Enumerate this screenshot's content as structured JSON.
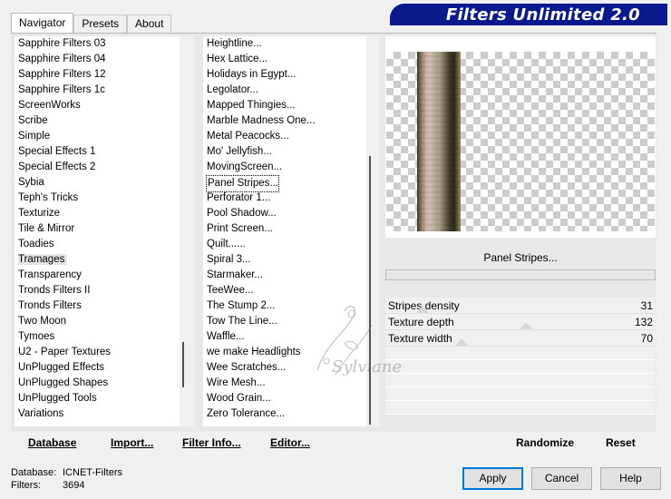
{
  "title": "Filters Unlimited 2.0",
  "tabs": [
    {
      "label": "Navigator",
      "active": true
    },
    {
      "label": "Presets",
      "active": false
    },
    {
      "label": "About",
      "active": false
    }
  ],
  "categories": {
    "items": [
      "Sapphire Filters 03",
      "Sapphire Filters 04",
      "Sapphire Filters 12",
      "Sapphire Filters 1c",
      "ScreenWorks",
      "Scribe",
      "Simple",
      "Special Effects 1",
      "Special Effects 2",
      "Sybia",
      "Teph's Tricks",
      "Texturize",
      "Tile & Mirror",
      "Toadies",
      "Tramages",
      "Transparency",
      "Tronds Filters II",
      "Tronds Filters",
      "Two Moon",
      "Tymoes",
      "U2 - Paper Textures",
      "UnPlugged Effects",
      "UnPlugged Shapes",
      "UnPlugged Tools",
      "Variations"
    ],
    "selected": "Tramages"
  },
  "filters": {
    "items": [
      "Heightline...",
      "Hex Lattice...",
      "Holidays in Egypt...",
      "Legolator...",
      "Mapped Thingies...",
      "Marble Madness One...",
      "Metal Peacocks...",
      "Mo' Jellyfish...",
      "MovingScreen...",
      "Panel Stripes...",
      "Perforator 1...",
      "Pool Shadow...",
      "Print Screen...",
      "Quilt......",
      "Spiral 3...",
      "Starmaker...",
      "TeeWee...",
      "The Stump 2...",
      "Tow The Line...",
      "Waffle...",
      "we make Headlights",
      "Wee Scratches...",
      "Wire Mesh...",
      "Wood Grain...",
      "Zero Tolerance..."
    ],
    "selected": "Panel Stripes..."
  },
  "preview": {
    "filter_name": "Panel Stripes..."
  },
  "parameters": [
    {
      "label": "Stripes density",
      "value": "31",
      "level": 0.12
    },
    {
      "label": "Texture depth",
      "value": "132",
      "level": 0.52
    },
    {
      "label": "Texture width",
      "value": "70",
      "level": 0.27
    }
  ],
  "bottom_buttons": {
    "database": "Database",
    "import": "Import...",
    "filter_info": "Filter Info...",
    "editor": "Editor...",
    "randomize": "Randomize",
    "reset": "Reset"
  },
  "status": {
    "database_label": "Database:",
    "database_value": "ICNET-Filters",
    "filters_label": "Filters:",
    "filters_value": "3694"
  },
  "dialog_buttons": {
    "apply": "Apply",
    "cancel": "Cancel",
    "help": "Help"
  },
  "watermark_text": "Sylviane"
}
